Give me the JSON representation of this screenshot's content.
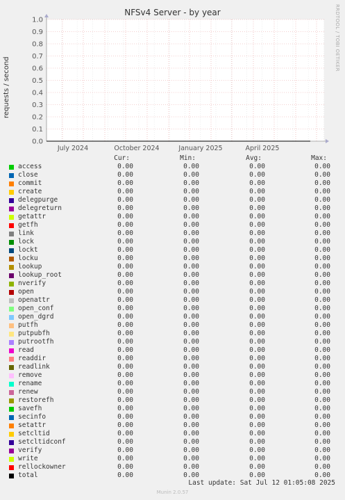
{
  "chart_data": {
    "type": "line",
    "title": "NFSv4 Server - by year",
    "ylabel": "requests / second",
    "ylim": [
      0,
      1.0
    ],
    "yticks": [
      "0.0",
      "0.1",
      "0.2",
      "0.3",
      "0.4",
      "0.5",
      "0.6",
      "0.7",
      "0.8",
      "0.9",
      "1.0"
    ],
    "xticks": [
      "July 2024",
      "October 2024",
      "January 2025",
      "April 2025"
    ],
    "grid": true,
    "series": [
      {
        "name": "access",
        "color": "#00cc00",
        "values": [
          0,
          0
        ]
      },
      {
        "name": "close",
        "color": "#0066b3",
        "values": [
          0,
          0
        ]
      },
      {
        "name": "commit",
        "color": "#ff8000",
        "values": [
          0,
          0
        ]
      },
      {
        "name": "create",
        "color": "#ffcc00",
        "values": [
          0,
          0
        ]
      },
      {
        "name": "delegpurge",
        "color": "#330099",
        "values": [
          0,
          0
        ]
      },
      {
        "name": "delegreturn",
        "color": "#990099",
        "values": [
          0,
          0
        ]
      },
      {
        "name": "getattr",
        "color": "#ccff00",
        "values": [
          0,
          0
        ]
      },
      {
        "name": "getfh",
        "color": "#ff0000",
        "values": [
          0,
          0
        ]
      },
      {
        "name": "link",
        "color": "#808080",
        "values": [
          0,
          0
        ]
      },
      {
        "name": "lock",
        "color": "#008f00",
        "values": [
          0,
          0
        ]
      },
      {
        "name": "lockt",
        "color": "#00487d",
        "values": [
          0,
          0
        ]
      },
      {
        "name": "locku",
        "color": "#b35a00",
        "values": [
          0,
          0
        ]
      },
      {
        "name": "lookup",
        "color": "#b38f00",
        "values": [
          0,
          0
        ]
      },
      {
        "name": "lookup_root",
        "color": "#6b006b",
        "values": [
          0,
          0
        ]
      },
      {
        "name": "nverify",
        "color": "#8fb300",
        "values": [
          0,
          0
        ]
      },
      {
        "name": "open",
        "color": "#b30000",
        "values": [
          0,
          0
        ]
      },
      {
        "name": "openattr",
        "color": "#bebebe",
        "values": [
          0,
          0
        ]
      },
      {
        "name": "open_conf",
        "color": "#80ff80",
        "values": [
          0,
          0
        ]
      },
      {
        "name": "open_dgrd",
        "color": "#80c9ff",
        "values": [
          0,
          0
        ]
      },
      {
        "name": "putfh",
        "color": "#ffc080",
        "values": [
          0,
          0
        ]
      },
      {
        "name": "putpubfh",
        "color": "#ffe680",
        "values": [
          0,
          0
        ]
      },
      {
        "name": "putrootfh",
        "color": "#aa80ff",
        "values": [
          0,
          0
        ]
      },
      {
        "name": "read",
        "color": "#ee00cc",
        "values": [
          0,
          0
        ]
      },
      {
        "name": "readdir",
        "color": "#ff8080",
        "values": [
          0,
          0
        ]
      },
      {
        "name": "readlink",
        "color": "#666600",
        "values": [
          0,
          0
        ]
      },
      {
        "name": "remove",
        "color": "#ffbfff",
        "values": [
          0,
          0
        ]
      },
      {
        "name": "rename",
        "color": "#00ffcc",
        "values": [
          0,
          0
        ]
      },
      {
        "name": "renew",
        "color": "#cc6699",
        "values": [
          0,
          0
        ]
      },
      {
        "name": "restorefh",
        "color": "#999900",
        "values": [
          0,
          0
        ]
      },
      {
        "name": "savefh",
        "color": "#00cc00",
        "values": [
          0,
          0
        ]
      },
      {
        "name": "secinfo",
        "color": "#0066b3",
        "values": [
          0,
          0
        ]
      },
      {
        "name": "setattr",
        "color": "#ff8000",
        "values": [
          0,
          0
        ]
      },
      {
        "name": "setcltid",
        "color": "#ffcc00",
        "values": [
          0,
          0
        ]
      },
      {
        "name": "setcltidconf",
        "color": "#330099",
        "values": [
          0,
          0
        ]
      },
      {
        "name": "verify",
        "color": "#990099",
        "values": [
          0,
          0
        ]
      },
      {
        "name": "write",
        "color": "#ccff00",
        "values": [
          0,
          0
        ]
      },
      {
        "name": "rellockowner",
        "color": "#ff0000",
        "values": [
          0,
          0
        ]
      },
      {
        "name": "total",
        "color": "#000000",
        "values": [
          0,
          0
        ]
      }
    ]
  },
  "legend": {
    "headers": {
      "cur": "Cur:",
      "min": "Min:",
      "avg": "Avg:",
      "max": "Max:"
    },
    "value": "0.00"
  },
  "vendor": "RRDTOOL / TOBI OETIKER",
  "last_update": "Last update: Sat Jul 12 01:05:08 2025",
  "munin": "Munin 2.0.57"
}
